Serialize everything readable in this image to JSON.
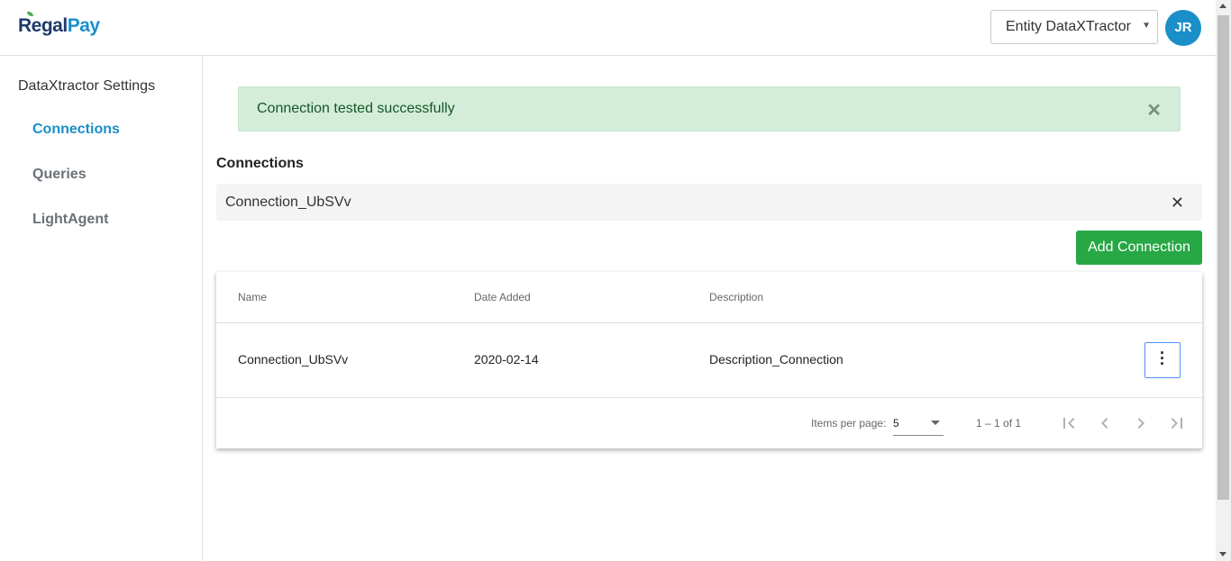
{
  "header": {
    "logo_part1": "Regal",
    "logo_part2": "Pay",
    "entity_select_value": "Entity DataXTractor",
    "avatar_initials": "JR"
  },
  "sidebar": {
    "title": "DataXtractor Settings",
    "items": [
      {
        "label": "Connections",
        "active": true
      },
      {
        "label": "Queries",
        "active": false
      },
      {
        "label": "LightAgent",
        "active": false
      }
    ]
  },
  "alert": {
    "message": "Connection tested successfully",
    "close_glyph": "✕"
  },
  "connections": {
    "title": "Connections",
    "filter_chip": "Connection_UbSVv",
    "chip_close_glyph": "✕",
    "add_button_label": "Add Connection"
  },
  "table": {
    "columns": [
      "Name",
      "Date Added",
      "Description"
    ],
    "rows": [
      {
        "name": "Connection_UbSVv",
        "date_added": "2020-02-14",
        "description": "Description_Connection"
      }
    ]
  },
  "paginator": {
    "items_per_page_label": "Items per page:",
    "items_per_page_value": "5",
    "range_label": "1 – 1 of 1"
  },
  "colors": {
    "brand_blue": "#1a8fc9",
    "brand_navy": "#1d3a6b",
    "success_green": "#28a745",
    "alert_bg": "#d4edda"
  }
}
